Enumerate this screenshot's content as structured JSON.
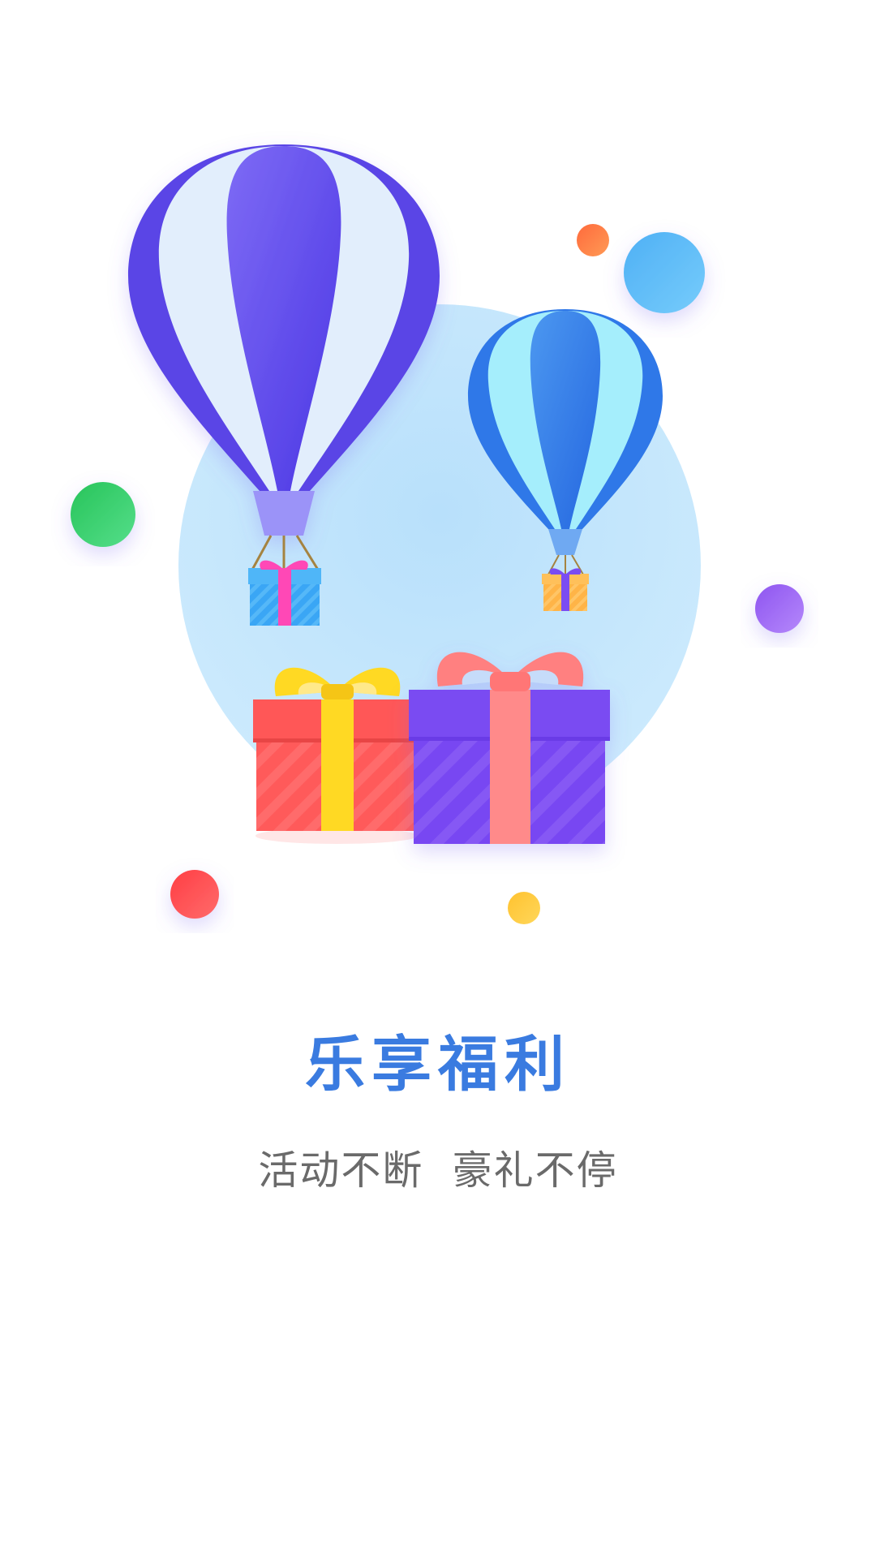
{
  "onboarding": {
    "title": "乐享福利",
    "subtitle": "活动不断  豪礼不停"
  },
  "colors": {
    "title": "#3A7BE0",
    "subtitle": "#6A6A6A",
    "background_circle": "#C9E8FC",
    "large_balloon": "#5A45E6",
    "small_balloon": "#2F78E8",
    "red_gift": "#FF5A5A",
    "purple_gift": "#7A4CF2"
  },
  "decorative_dots": [
    "orange-dot",
    "blue-dot",
    "green-dot",
    "purple-dot",
    "red-dot",
    "yellow-dot"
  ]
}
